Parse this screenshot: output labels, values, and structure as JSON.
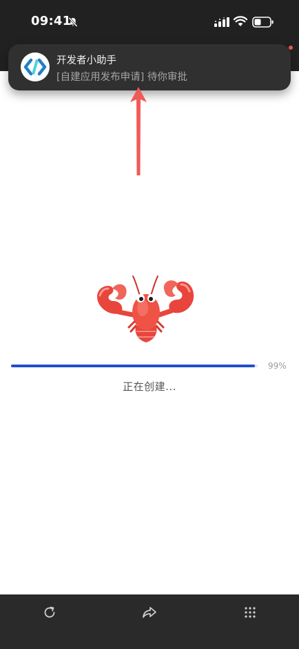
{
  "status_bar": {
    "time": "09:41"
  },
  "notification": {
    "title": "开发者小助手",
    "body": "[自建应用发布申请] 待你审批",
    "icon": "developer-assistant-logo"
  },
  "progress": {
    "percent": 0.99,
    "label": "99%"
  },
  "status": {
    "text": "正在创建..."
  },
  "toolbar": {
    "icons": [
      "refresh-icon",
      "share-icon",
      "more-grid-icon"
    ]
  },
  "colors": {
    "accent": "#1f4fc9",
    "arrow": "#f05a57",
    "dark_bar": "#212121"
  }
}
